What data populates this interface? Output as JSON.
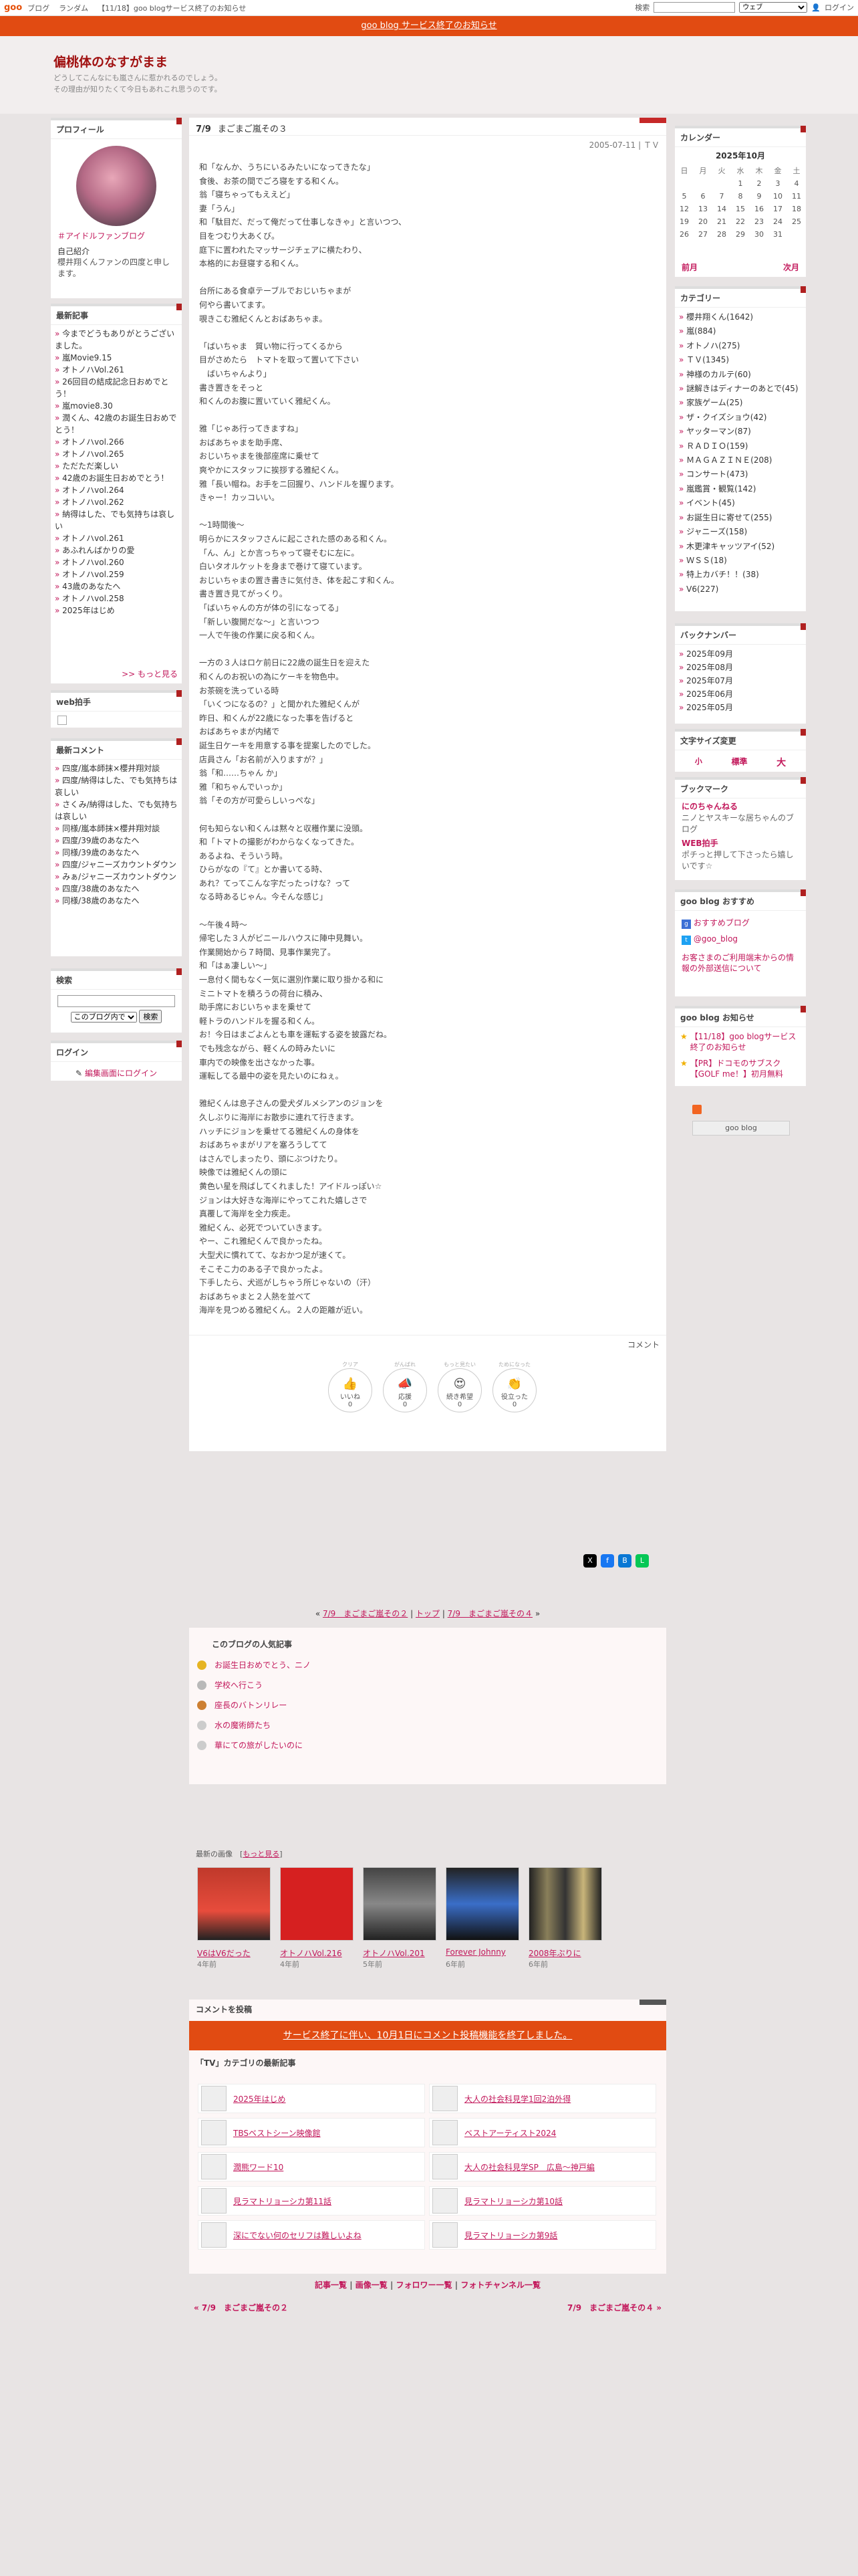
{
  "topbar": {
    "logo": "goo",
    "links": [
      "ブログ",
      "ランダム",
      "【11/18】goo blogサービス終了のお知らせ"
    ],
    "search_label": "検索",
    "search_select": "ウェブ",
    "login": "ログイン"
  },
  "notice_bar": "goo blog サービス終了のお知らせ",
  "blog": {
    "title": "偏桃体のなすがまま",
    "desc1": "どうしてこんなにも嵐さんに惹かれるのでしょう。",
    "desc2": "その理由が知りたくて今日もあれこれ思うのです。"
  },
  "profile": {
    "title": "プロフィール",
    "link": "＃アイドルファンブログ",
    "intro_label": "自己紹介",
    "intro": "櫻井翔くんファンの四度と申します。"
  },
  "recent": {
    "title": "最新記事",
    "items": [
      "今までどうもありがとうございました。",
      "嵐Movie9.15",
      "オトノハVol.261",
      "26回目の結成記念日おめでとう！",
      "嵐movie8.30",
      "潤くん、42歳のお誕生日おめでとう！",
      "オトノハvol.266",
      "オトノハvol.265",
      "ただただ楽しい",
      "42歳のお誕生日おめでとう！",
      "オトノハvol.264",
      "オトノハvol.262",
      "納得はした、でも気持ちは哀しい",
      "オトノハvol.261",
      "あふれんばかりの愛",
      "オトノハvol.260",
      "オトノハvol.259",
      "43歳のあなたへ",
      "オトノハvol.258",
      "2025年はじめ"
    ],
    "more": ">> もっと見る"
  },
  "webclap": {
    "title": "web拍手"
  },
  "comments": {
    "title": "最新コメント",
    "items": [
      "四度/嵐本師抹×櫻井翔対談",
      "四度/納得はした、でも気持ちは哀しい",
      "さくみ/納得はした、でも気持ちは哀しい",
      "同様/嵐本師抹×櫻井翔対談",
      "四度/39歳のあなたへ",
      "同様/39歳のあなたへ",
      "四度/ジャニーズカウントダウン",
      "みぁ/ジャニーズカウントダウン",
      "四度/38歳のあなたへ",
      "同様/38歳のあなたへ"
    ]
  },
  "search": {
    "title": "検索",
    "select": "このブログ内で",
    "button": "検索"
  },
  "login": {
    "title": "ログイン",
    "link": "編集画面にログイン"
  },
  "entry": {
    "date_label": "7/9",
    "title": "まごまご嵐その３",
    "date": "2005-07-11 | ＴＶ",
    "comment_label": "コメント",
    "body": "和「なんか、うちにいるみたいになってきたな」\n食後、お茶の間でごろ寝をする和くん。\n翁「寝ちゃってもええど」\n妻「うん」\n和「駄目だ、だって俺だって仕事しなきゃ」と言いつつ、\n目をつむり大あくび。\n庭下に置われたマッサージチェアに横たわり、\n本格的にお昼寝する和くん。\n\n台所にある食卓テーブルでおじいちゃまが\n何やら書いてます。\n覗きこむ雅紀くんとおばあちゃま。\n\n「ばいちゃま　質い物に行ってくるから\n目がさめたら　トマトを取って置いて下さい\n　ばいちゃんより」\n書き置きをそっと\n和くんのお腹に置いていく雅紀くん。\n\n雅「じゃあ行ってきますね」\nおばあちゃまを助手席、\nおじいちゃまを後部座席に乗せて\n爽やかにスタッフに挨拶する雅紀くん。\n雅「長い帽ね。お手をニ回握り、ハンドルを握ります。\nきゃー！カッコいい。\n\n～1時間後～\n明らかにスタッフさんに起こされた感のある和くん。\n「ん、ん」とか言っちゃって寝そむに左に。\n白いタオルケットを身まで巻けて寝ています。\nおじいちゃまの置き書きに気付き、体を起こす和くん。\n書き置き見てがっくり。\n「ばいちゃんの方が体の引になってる」\n「新しい腹開だな～」と言いつつ\n一人で午後の作業に戻る和くん。\n\n一方の３人はロケ前日に22歳の誕生日を迎えた\n和くんのお祝いの為にケーキを物色中。\nお茶碗を洗っている時\n「いくつになるの？」と聞かれた雅紀くんが\n昨日、和くんが22歳になった事を告げると\nおばあちゃまが内緒で\n誕生日ケーキを用意する事を提案したのでした。\n店員さん「お名前が入りますが？」\n翁「和……ちゃん か」\n雅「和ちゃんでいっか」\n翁「その方が可愛らしいっぺな」\n\n何も知らない和くんは黙々と収穫作業に没頭。\n和「トマトの撮影がわからなくなってきた。\nあるよね、そういう時。\nひらがなの『て』とか書いてる時、\nあれ？てってこんな字だったっけな？って\nなる時あるじゃん。今そんな感じ」\n\n～午後４時～\n帰宅した３人がビニールハウスに陣中見舞い。\n作業開始から７時間、見事作業完了。\n和「はぁ凄しい～」\n一息付く間もなく一気に選別作業に取り掛かる和に\nミニトマトを積ろうの荷台に積み、\n助手席におじいちゃまを乗せて\n軽トラのハンドルを握る和くん。\nお！今日はまごよんとも車を運転する姿を披露だね。\nでも残念ながら、軽くんの時みたいに\n車内での映像を出さなかった事。\n運転してる最中の姿を見たいのにねぇ。\n\n雅紀くんは息子さんの愛犬ダルメシアンのジョンを\n久しぶりに海岸にお散歩に連れて行きます。\nハッチにジョンを乗せてる雅紀くんの身体を\nおばあちゃまがリアを塞ろうしてて\nはさんでしまったり、頭にぶつけたり。\n映像では雅紀くんの頭に\n黄色い星を飛ばしてくれました！アイドルっぽい☆\nジョンは大好きな海岸にやってこれた嬉しさで\n真覆して海岸を全力疾走。\n雅紀くん、必死でついていきます。\nやー、これ雅紀くんで良かったね。\n大型犬に慣れてて、なおかつ足が速くて。\nそこそこ力のある子で良かったよ。\n下手したら、犬巡がしちゃう所じゃないの（汗）\nおばあちゃまと２人熱を並べて\n海岸を見つめる雅紀くん。２人の距離が近い。"
  },
  "reactions": [
    {
      "label": "いいね",
      "count": "0"
    },
    {
      "label": "応援",
      "count": "0"
    },
    {
      "label": "続き希望",
      "count": "0"
    },
    {
      "label": "役立った",
      "count": "0"
    }
  ],
  "reaction_heads": [
    "クリア",
    "がんばれ",
    "もっと見たい",
    "ためになった"
  ],
  "nav": {
    "prev": "7/9　まごまご嵐その２",
    "top": "トップ",
    "next": "7/9　まごまご嵐その４"
  },
  "popular": {
    "title": "このブログの人気記事",
    "items": [
      "お誕生日おめでとう、ニノ",
      "学校へ行こう",
      "座長のバトンリレー",
      "水の魔術師たち",
      "華にての旅がしたいのに"
    ]
  },
  "images": {
    "title": "最新の画像",
    "more": "もっと見る",
    "items": [
      {
        "label": "V6はV6だった",
        "age": "4年前"
      },
      {
        "label": "オトノハVol.216",
        "age": "4年前"
      },
      {
        "label": "オトノハVol.201",
        "age": "5年前"
      },
      {
        "label": "Forever Johnny",
        "age": "6年前"
      },
      {
        "label": "2008年ぶりに",
        "age": "6年前"
      }
    ]
  },
  "comment_post": {
    "title": "コメントを投稿",
    "notice": "サービス終了に伴い、10月1日にコメント投稿機能を終了しました。"
  },
  "category_latest": {
    "title": "「TV」カテゴリの最新記事",
    "items": [
      "2025年はじめ",
      "大人の社会科見学1回2泊外得",
      "TBSベストシーン映像館",
      "ベストアーティスト2024",
      "潤熊ワード10",
      "大人の社会科見学SP　広島～神戸編",
      "見ラマトリョーシカ第11話",
      "見ラマトリョーシカ第10話",
      "深にでない何のセリフは難しいよね",
      "見ラマトリョーシカ第9話"
    ]
  },
  "footer_links": [
    "記事一覧",
    "画像一覧",
    "フォロワー一覧",
    "フォトチャンネル一覧"
  ],
  "footer_nav": {
    "prev": "« 7/9　まごまご嵐その２",
    "next": "7/9　まごまご嵐その４ »"
  },
  "calendar": {
    "title": "カレンダー",
    "month": "2025年10月",
    "days": [
      "日",
      "月",
      "火",
      "水",
      "木",
      "金",
      "土"
    ],
    "rows": [
      [
        "",
        "",
        "",
        "1",
        "2",
        "3",
        "4"
      ],
      [
        "5",
        "6",
        "7",
        "8",
        "9",
        "10",
        "11"
      ],
      [
        "12",
        "13",
        "14",
        "15",
        "16",
        "17",
        "18"
      ],
      [
        "19",
        "20",
        "21",
        "22",
        "23",
        "24",
        "25"
      ],
      [
        "26",
        "27",
        "28",
        "29",
        "30",
        "31",
        ""
      ]
    ],
    "prev": "前月",
    "next": "次月"
  },
  "categories": {
    "title": "カテゴリー",
    "items": [
      "櫻井翔くん(1642)",
      "嵐(884)",
      "オトノハ(275)",
      "ＴＶ(1345)",
      "神様のカルテ(60)",
      "謎解きはディナーのあとで(45)",
      "家族ゲーム(25)",
      "ザ・クイズショウ(42)",
      "ヤッターマン(87)",
      "ＲＡＤＩＯ(159)",
      "ＭＡＧＡＺＩＮＥ(208)",
      "コンサート(473)",
      "嵐鑑賞・観覧(142)",
      "イベント(45)",
      "お誕生日に寄せて(255)",
      "ジャニーズ(158)",
      "木更津キャッツアイ(52)",
      "ＷＳＳ(18)",
      "特上カバチ！！(38)",
      "V6(227)"
    ]
  },
  "backnumber": {
    "title": "バックナンバー",
    "items": [
      "2025年09月",
      "2025年08月",
      "2025年07月",
      "2025年06月",
      "2025年05月"
    ]
  },
  "fontsize": {
    "title": "文字サイズ変更",
    "small": "小",
    "mid": "標準",
    "large": "大"
  },
  "bookmark": {
    "title": "ブックマーク",
    "items": [
      {
        "name": "にのちゃんねる",
        "desc": "ニノとヤスキーな居ちゃんのブログ"
      },
      {
        "name": "WEB拍手",
        "desc": "ポチっと押して下さったら嬉しいです☆"
      }
    ]
  },
  "goo_recommend": {
    "title": "goo blog おすすめ",
    "items": [
      "おすすめブログ",
      "@goo_blog"
    ],
    "notice": "お客さまのご利用端末からの情報の外部送信について"
  },
  "goo_notice": {
    "title": "goo blog お知らせ",
    "items": [
      "【11/18】goo blogサービス終了のお知らせ",
      "【PR】ドコモのサブスク【GOLF me！】初月無料"
    ]
  },
  "badge": "goo blog"
}
